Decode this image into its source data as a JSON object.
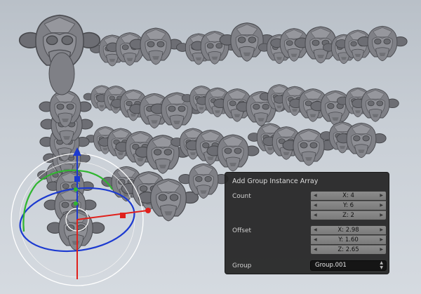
{
  "colors": {
    "background_top": "#b9c0c8",
    "monkey_mesh": "#7d7e84",
    "gizmo_x": "#e0201b",
    "gizmo_y": "#2fb52f",
    "gizmo_z": "#1c3ad0",
    "panel_bg": "#242424"
  },
  "viewport": {
    "object": "monkey-head-instances",
    "gizmo": "rotate-manipulator"
  },
  "panel": {
    "title": "Add Group Instance Array",
    "count": {
      "label": "Count",
      "x": "X: 4",
      "y": "Y: 6",
      "z": "Z: 2"
    },
    "offset": {
      "label": "Offset",
      "x": "X: 2.98",
      "y": "Y: 1.60",
      "z": "Z: 2.65"
    },
    "group": {
      "label": "Group",
      "value": "Group.001"
    }
  }
}
